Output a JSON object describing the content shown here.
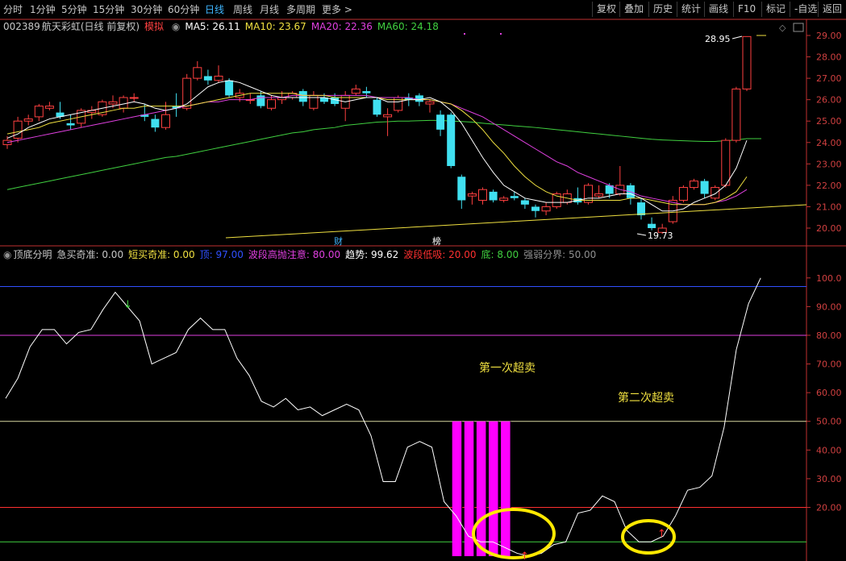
{
  "toolbar": {
    "tabs": [
      "分时",
      "1分钟",
      "5分钟",
      "15分钟",
      "30分钟",
      "60分钟",
      "日线",
      "周线",
      "月线",
      "多周期",
      "更多 >"
    ],
    "active_tab": "日线",
    "right_buttons": [
      "复权",
      "叠加",
      "历史",
      "统计",
      "画线",
      "F10",
      "标记",
      "-自选",
      "返回"
    ]
  },
  "stock": {
    "code": "002389",
    "name": "航天彩虹",
    "period": "(日线 前复权)",
    "mode": "模拟"
  },
  "ma": [
    {
      "label": "MA5: 26.11",
      "color": "#ffffff"
    },
    {
      "label": "MA10: 23.67",
      "color": "#f0e040"
    },
    {
      "label": "MA20: 22.36",
      "color": "#e040e0"
    },
    {
      "label": "MA60: 24.18",
      "color": "#40d040"
    }
  ],
  "price_axis": [
    "29.00",
    "28.00",
    "27.00",
    "26.00",
    "25.00",
    "24.00",
    "23.00",
    "22.00",
    "21.00",
    "20.00"
  ],
  "price_annotations": {
    "high": "28.95",
    "low": "19.73"
  },
  "event_markers": [
    "财",
    "榜"
  ],
  "indicator": {
    "name": "顶底分明",
    "params": [
      {
        "label": "急买奇准: 0.00",
        "color": "#c8c8c8"
      },
      {
        "label": "短买奇准: 0.00",
        "color": "#f0e040"
      },
      {
        "label": "顶: 97.00",
        "color": "#3050ff"
      },
      {
        "label": "波段高抛注意: 80.00",
        "color": "#e040e0"
      },
      {
        "label": "趋势: 99.62",
        "color": "#ffffff"
      },
      {
        "label": "波段低吸: 20.00",
        "color": "#ff3030"
      },
      {
        "label": "底: 8.00",
        "color": "#40d040"
      },
      {
        "label": "强弱分界: 50.00",
        "color": "#909090"
      }
    ],
    "axis": [
      "100.0",
      "90.00",
      "80.00",
      "70.00",
      "60.00",
      "50.00",
      "40.00",
      "30.00",
      "20.00"
    ],
    "annotation_1": "第一次超卖",
    "annotation_2": "第二次超卖"
  },
  "colors": {
    "up": "#ff4040",
    "down": "#40e0f0",
    "ma5": "#ffffff",
    "ma10": "#f0e040",
    "ma20": "#e040e0",
    "ma60": "#40d040",
    "axis_red": "#c03030",
    "bar_magenta": "#ff00ff",
    "ellipse": "#ffe800"
  },
  "chart_data": {
    "type": "candlestick",
    "price_ylim": [
      19.5,
      29.3
    ],
    "candles": [
      {
        "o": 23.9,
        "c": 24.1,
        "h": 24.3,
        "l": 23.7
      },
      {
        "o": 24.2,
        "c": 25.0,
        "h": 25.2,
        "l": 24.0
      },
      {
        "o": 25.0,
        "c": 25.1,
        "h": 25.3,
        "l": 24.8
      },
      {
        "o": 25.2,
        "c": 25.7,
        "h": 25.8,
        "l": 25.0
      },
      {
        "o": 25.6,
        "c": 25.7,
        "h": 25.9,
        "l": 25.5
      },
      {
        "o": 25.4,
        "c": 25.2,
        "h": 25.9,
        "l": 25.1
      },
      {
        "o": 24.9,
        "c": 24.8,
        "h": 25.3,
        "l": 24.6
      },
      {
        "o": 24.9,
        "c": 25.5,
        "h": 25.6,
        "l": 24.7
      },
      {
        "o": 25.4,
        "c": 25.5,
        "h": 25.7,
        "l": 25.1
      },
      {
        "o": 25.3,
        "c": 25.9,
        "h": 26.0,
        "l": 25.2
      },
      {
        "o": 25.8,
        "c": 25.9,
        "h": 26.2,
        "l": 25.6
      },
      {
        "o": 25.6,
        "c": 26.1,
        "h": 26.2,
        "l": 25.4
      },
      {
        "o": 26.1,
        "c": 26.1,
        "h": 26.3,
        "l": 25.9
      },
      {
        "o": 25.3,
        "c": 25.2,
        "h": 25.8,
        "l": 25.0
      },
      {
        "o": 25.1,
        "c": 24.7,
        "h": 25.3,
        "l": 24.5
      },
      {
        "o": 24.7,
        "c": 25.3,
        "h": 25.9,
        "l": 24.6
      },
      {
        "o": 25.7,
        "c": 25.6,
        "h": 26.3,
        "l": 25.2
      },
      {
        "o": 25.6,
        "c": 27.0,
        "h": 27.2,
        "l": 25.5
      },
      {
        "o": 27.0,
        "c": 27.5,
        "h": 27.8,
        "l": 26.9
      },
      {
        "o": 27.1,
        "c": 26.9,
        "h": 27.4,
        "l": 26.7
      },
      {
        "o": 26.9,
        "c": 27.1,
        "h": 27.6,
        "l": 26.8
      },
      {
        "o": 26.9,
        "c": 26.2,
        "h": 27.0,
        "l": 26.1
      },
      {
        "o": 26.1,
        "c": 26.3,
        "h": 26.5,
        "l": 25.9
      },
      {
        "o": 26.0,
        "c": 26.0,
        "h": 26.3,
        "l": 25.8
      },
      {
        "o": 26.2,
        "c": 25.7,
        "h": 26.4,
        "l": 25.6
      },
      {
        "o": 25.6,
        "c": 26.0,
        "h": 26.2,
        "l": 25.5
      },
      {
        "o": 26.0,
        "c": 26.1,
        "h": 26.4,
        "l": 25.8
      },
      {
        "o": 26.1,
        "c": 26.3,
        "h": 26.4,
        "l": 26.0
      },
      {
        "o": 26.4,
        "c": 25.9,
        "h": 26.5,
        "l": 25.7
      },
      {
        "o": 25.6,
        "c": 26.2,
        "h": 26.4,
        "l": 25.5
      },
      {
        "o": 26.1,
        "c": 25.9,
        "h": 26.3,
        "l": 25.8
      },
      {
        "o": 26.1,
        "c": 25.8,
        "h": 26.3,
        "l": 25.7
      },
      {
        "o": 25.6,
        "c": 26.2,
        "h": 26.4,
        "l": 25.0
      },
      {
        "o": 26.3,
        "c": 26.5,
        "h": 26.7,
        "l": 26.2
      },
      {
        "o": 26.4,
        "c": 26.3,
        "h": 26.6,
        "l": 26.1
      },
      {
        "o": 26.0,
        "c": 25.3,
        "h": 26.1,
        "l": 25.2
      },
      {
        "o": 25.2,
        "c": 25.3,
        "h": 25.6,
        "l": 24.3
      },
      {
        "o": 25.5,
        "c": 26.1,
        "h": 26.2,
        "l": 25.4
      },
      {
        "o": 26.1,
        "c": 26.0,
        "h": 26.3,
        "l": 25.7
      },
      {
        "o": 26.2,
        "c": 25.9,
        "h": 26.3,
        "l": 25.7
      },
      {
        "o": 25.8,
        "c": 25.9,
        "h": 26.0,
        "l": 25.4
      },
      {
        "o": 25.3,
        "c": 24.6,
        "h": 25.5,
        "l": 24.3
      },
      {
        "o": 25.3,
        "c": 22.9,
        "h": 25.4,
        "l": 22.8
      },
      {
        "o": 22.4,
        "c": 21.3,
        "h": 22.5,
        "l": 20.9
      },
      {
        "o": 21.5,
        "c": 21.6,
        "h": 21.7,
        "l": 21.1
      },
      {
        "o": 21.3,
        "c": 21.8,
        "h": 21.9,
        "l": 21.1
      },
      {
        "o": 21.7,
        "c": 21.3,
        "h": 21.8,
        "l": 21.2
      },
      {
        "o": 21.3,
        "c": 21.4,
        "h": 21.5,
        "l": 21.2
      },
      {
        "o": 21.5,
        "c": 21.4,
        "h": 21.7,
        "l": 21.3
      },
      {
        "o": 21.3,
        "c": 21.1,
        "h": 21.4,
        "l": 20.9
      },
      {
        "o": 21.0,
        "c": 20.8,
        "h": 21.1,
        "l": 20.5
      },
      {
        "o": 20.8,
        "c": 21.0,
        "h": 21.2,
        "l": 20.6
      },
      {
        "o": 21.0,
        "c": 21.6,
        "h": 21.7,
        "l": 20.9
      },
      {
        "o": 21.2,
        "c": 21.6,
        "h": 21.8,
        "l": 21.1
      },
      {
        "o": 21.4,
        "c": 21.2,
        "h": 21.9,
        "l": 21.1
      },
      {
        "o": 21.2,
        "c": 22.0,
        "h": 22.1,
        "l": 21.1
      },
      {
        "o": 21.5,
        "c": 21.6,
        "h": 22.0,
        "l": 21.4
      },
      {
        "o": 22.0,
        "c": 21.6,
        "h": 22.1,
        "l": 21.4
      },
      {
        "o": 21.6,
        "c": 22.0,
        "h": 22.9,
        "l": 21.5
      },
      {
        "o": 22.0,
        "c": 21.4,
        "h": 22.1,
        "l": 21.1
      },
      {
        "o": 21.2,
        "c": 20.6,
        "h": 21.4,
        "l": 20.4
      },
      {
        "o": 20.2,
        "c": 20.0,
        "h": 20.5,
        "l": 19.9
      },
      {
        "o": 19.8,
        "c": 20.0,
        "h": 20.2,
        "l": 19.73
      },
      {
        "o": 20.3,
        "c": 21.3,
        "h": 21.5,
        "l": 20.2
      },
      {
        "o": 21.3,
        "c": 21.9,
        "h": 22.0,
        "l": 21.2
      },
      {
        "o": 21.9,
        "c": 22.2,
        "h": 22.3,
        "l": 21.8
      },
      {
        "o": 22.2,
        "c": 21.6,
        "h": 22.3,
        "l": 21.4
      },
      {
        "o": 21.4,
        "c": 21.9,
        "h": 22.0,
        "l": 21.3
      },
      {
        "o": 22.0,
        "c": 24.1,
        "h": 24.2,
        "l": 21.9
      },
      {
        "o": 24.1,
        "c": 26.5,
        "h": 26.6,
        "l": 24.0
      },
      {
        "o": 26.5,
        "c": 28.95,
        "h": 28.95,
        "l": 26.4
      }
    ],
    "ma5": [
      24.2,
      24.4,
      24.7,
      24.9,
      25.1,
      25.2,
      25.3,
      25.4,
      25.5,
      25.6,
      25.7,
      25.8,
      25.9,
      25.8,
      25.6,
      25.5,
      25.6,
      25.8,
      26.2,
      26.6,
      26.8,
      26.9,
      26.8,
      26.6,
      26.4,
      26.2,
      26.1,
      26.1,
      26.1,
      26.1,
      26.1,
      26.0,
      25.9,
      26.0,
      26.1,
      26.1,
      25.9,
      25.9,
      26.0,
      26.0,
      26.1,
      25.9,
      25.5,
      24.9,
      24.1,
      23.3,
      22.6,
      22.0,
      21.7,
      21.4,
      21.3,
      21.2,
      21.2,
      21.2,
      21.3,
      21.4,
      21.4,
      21.5,
      21.6,
      21.6,
      21.4,
      21.1,
      20.8,
      20.8,
      20.9,
      21.2,
      21.4,
      21.6,
      22.0,
      22.8,
      24.1
    ],
    "ma10": [
      24.4,
      24.5,
      24.6,
      24.7,
      24.9,
      25.0,
      25.1,
      25.2,
      25.3,
      25.4,
      25.5,
      25.6,
      25.6,
      25.7,
      25.7,
      25.7,
      25.7,
      25.7,
      25.8,
      25.9,
      26.0,
      26.1,
      26.2,
      26.3,
      26.3,
      26.3,
      26.3,
      26.3,
      26.2,
      26.2,
      26.2,
      26.1,
      26.1,
      26.1,
      26.1,
      26.1,
      26.0,
      26.0,
      26.0,
      26.0,
      26.0,
      25.9,
      25.8,
      25.5,
      25.1,
      24.6,
      24.0,
      23.5,
      22.9,
      22.4,
      22.0,
      21.7,
      21.5,
      21.4,
      21.3,
      21.3,
      21.3,
      21.3,
      21.3,
      21.4,
      21.4,
      21.3,
      21.2,
      21.1,
      21.1,
      21.1,
      21.1,
      21.2,
      21.4,
      21.7,
      22.4
    ],
    "ma20": [
      24.0,
      24.1,
      24.2,
      24.3,
      24.4,
      24.5,
      24.6,
      24.7,
      24.8,
      24.9,
      25.0,
      25.1,
      25.2,
      25.3,
      25.4,
      25.5,
      25.6,
      25.7,
      25.8,
      25.9,
      25.9,
      26.0,
      26.0,
      26.0,
      26.1,
      26.1,
      26.1,
      26.2,
      26.2,
      26.2,
      26.2,
      26.2,
      26.2,
      26.2,
      26.2,
      26.1,
      26.1,
      26.1,
      26.1,
      26.0,
      26.0,
      25.9,
      25.8,
      25.6,
      25.4,
      25.2,
      24.9,
      24.6,
      24.3,
      24.0,
      23.7,
      23.4,
      23.1,
      22.9,
      22.6,
      22.4,
      22.2,
      22.0,
      21.8,
      21.7,
      21.5,
      21.4,
      21.3,
      21.2,
      21.1,
      21.1,
      21.1,
      21.2,
      21.3,
      21.5,
      21.8
    ],
    "ma60": [
      21.8,
      21.9,
      22.0,
      22.1,
      22.2,
      22.3,
      22.4,
      22.5,
      22.6,
      22.7,
      22.8,
      22.9,
      23.0,
      23.1,
      23.2,
      23.3,
      23.35,
      23.45,
      23.55,
      23.65,
      23.75,
      23.85,
      23.95,
      24.05,
      24.15,
      24.25,
      24.35,
      24.45,
      24.5,
      24.6,
      24.65,
      24.7,
      24.8,
      24.85,
      24.9,
      24.95,
      24.97,
      25.0,
      25.0,
      25.02,
      25.03,
      25.03,
      25.0,
      24.98,
      24.95,
      24.9,
      24.86,
      24.82,
      24.78,
      24.74,
      24.7,
      24.65,
      24.6,
      24.55,
      24.5,
      24.45,
      24.4,
      24.35,
      24.3,
      24.25,
      24.2,
      24.15,
      24.12,
      24.1,
      24.08,
      24.06,
      24.05,
      24.05,
      24.08,
      24.12,
      24.18
    ],
    "trendline": [
      {
        "i": 0,
        "v": 19.7
      },
      {
        "i": 70,
        "v": 21.0
      }
    ],
    "indicator_ylim": [
      3,
      105
    ],
    "indicator_levels": [
      {
        "value": 97,
        "color": "#3050ff"
      },
      {
        "value": 80,
        "color": "#e040e0"
      },
      {
        "value": 50,
        "color": "#d8d8a0"
      },
      {
        "value": 20,
        "color": "#ff3030"
      },
      {
        "value": 8,
        "color": "#40d040"
      }
    ],
    "indicator_line": [
      58,
      65,
      76,
      82,
      82,
      77,
      81,
      82,
      89,
      95,
      90,
      85,
      70,
      72,
      74,
      82,
      86,
      82,
      82,
      72,
      66,
      57,
      55,
      58,
      54,
      55,
      52,
      54,
      56,
      54,
      45,
      29,
      29,
      41,
      43,
      41,
      22,
      17,
      10,
      8,
      8,
      6,
      4,
      3,
      4,
      7,
      8,
      18,
      19,
      24,
      22,
      12,
      8,
      8,
      10,
      17,
      26,
      27,
      31,
      48,
      75,
      91,
      100
    ],
    "magenta_bars": [
      {
        "i": 37,
        "v": 50
      },
      {
        "i": 38,
        "v": 50
      },
      {
        "i": 39,
        "v": 50
      },
      {
        "i": 40,
        "v": 50
      },
      {
        "i": 41,
        "v": 50
      }
    ]
  }
}
